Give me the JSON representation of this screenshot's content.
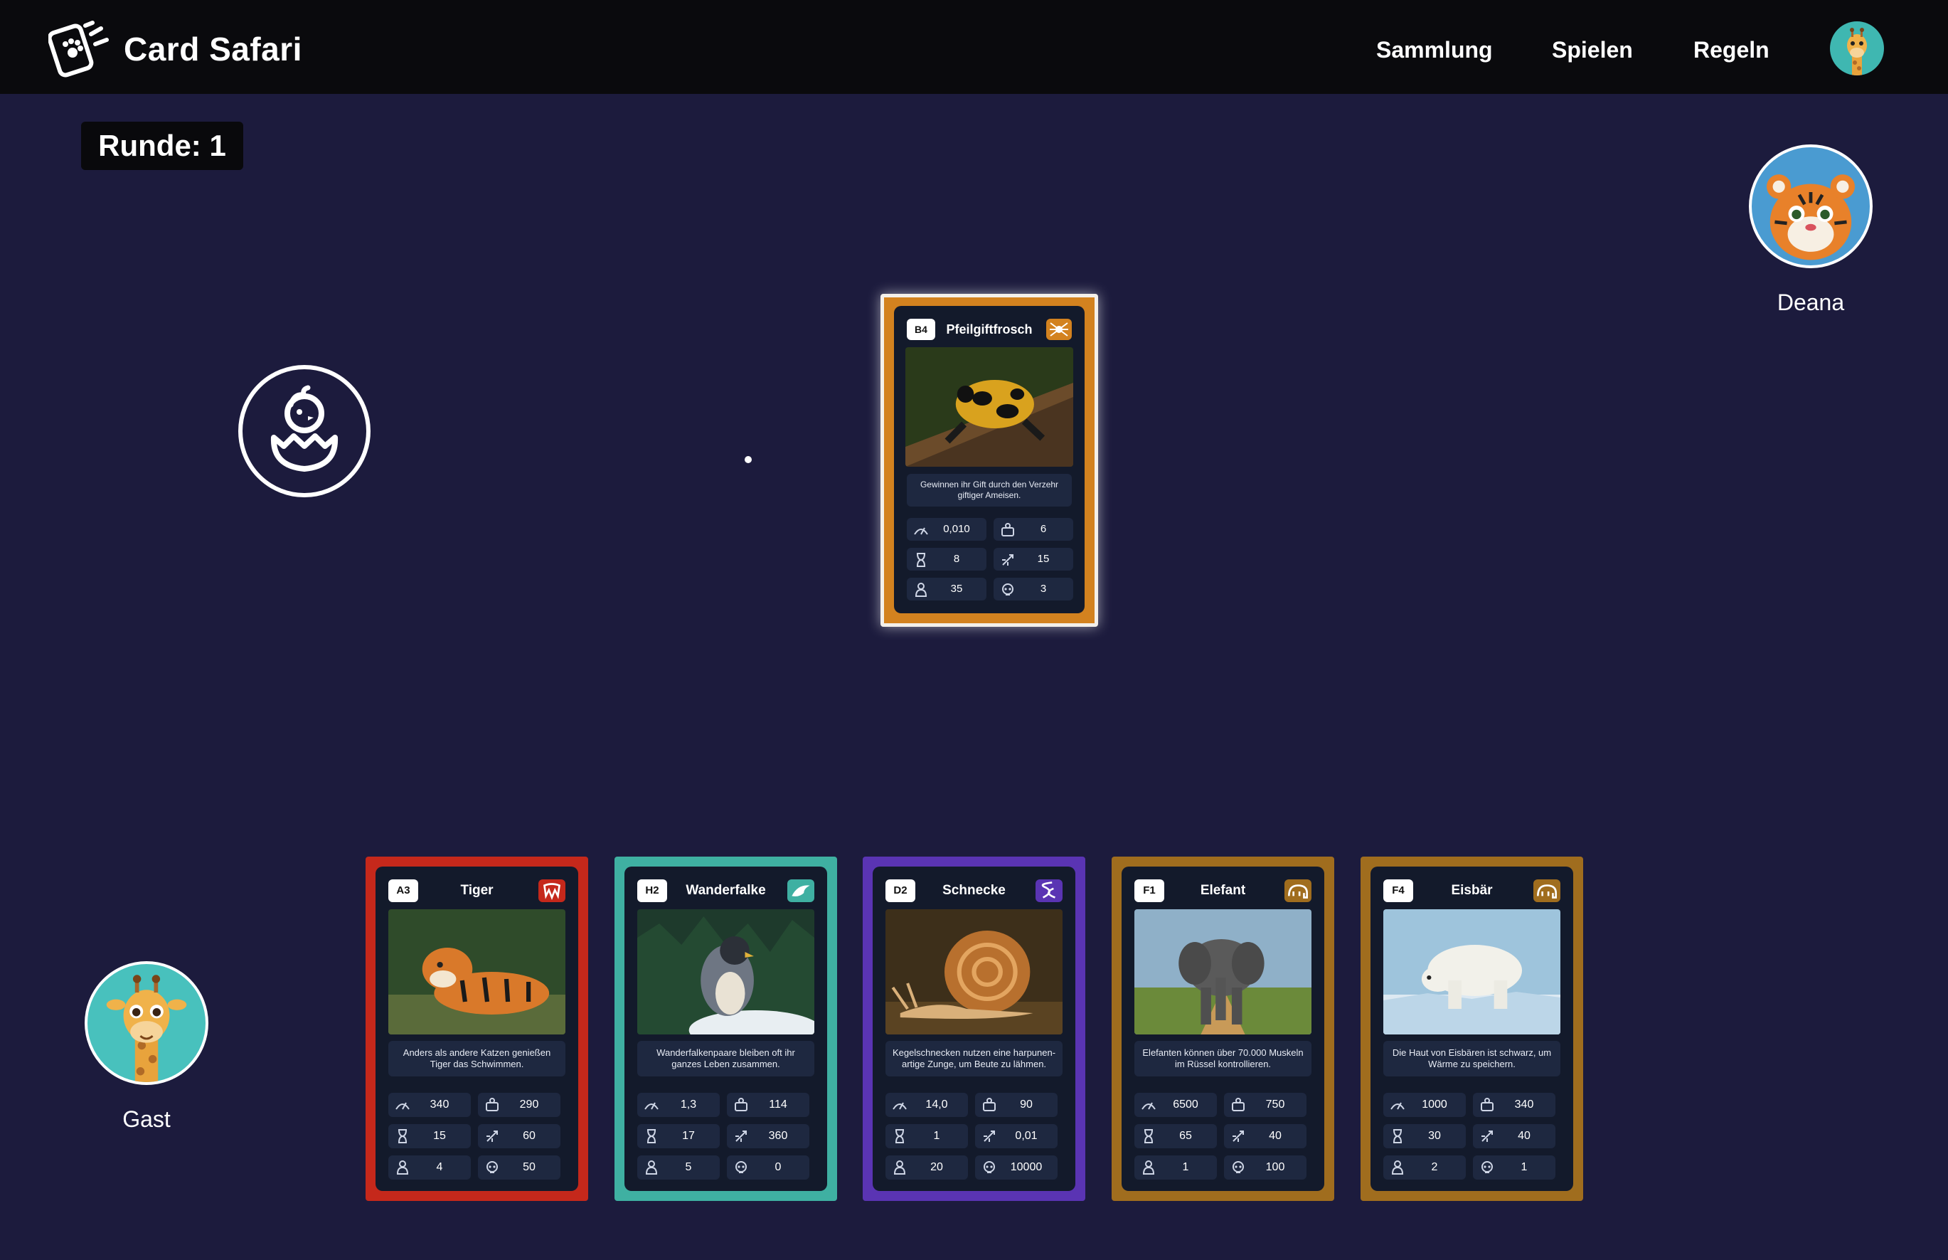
{
  "app": {
    "title": "Card Safari",
    "logo_icon": "paw-cards-icon"
  },
  "nav": {
    "items": [
      {
        "label": "Sammlung"
      },
      {
        "label": "Spielen"
      },
      {
        "label": "Regeln"
      }
    ],
    "avatar_icon": "giraffe-avatar-icon"
  },
  "round": {
    "label": "Runde: 1"
  },
  "opponent": {
    "name": "Deana",
    "avatar_icon": "tiger-avatar-icon"
  },
  "guest": {
    "name": "Gast",
    "avatar_icon": "giraffe-avatar-icon"
  },
  "deck": {
    "icon": "hatching-chick-icon"
  },
  "stat_icons": [
    "speed-icon",
    "weight-icon",
    "lifespan-hourglass-icon",
    "attack-icon",
    "offspring-icon",
    "danger-skull-icon"
  ],
  "played_card": {
    "code": "B4",
    "name": "Pfeilgiftfrosch",
    "type_icon": "spider-icon",
    "color": "#d3821f",
    "description": "Gewinnen ihr Gift durch den Verzehr giftiger Ameisen.",
    "stats": [
      "0,010",
      "6",
      "8",
      "15",
      "35",
      "3"
    ]
  },
  "hand": [
    {
      "code": "A3",
      "name": "Tiger",
      "type_icon": "fangs-icon",
      "color": "#c5281b",
      "description": "Anders als andere Katzen genießen Tiger das Schwimmen.",
      "stats": [
        "340",
        "290",
        "15",
        "60",
        "4",
        "50"
      ]
    },
    {
      "code": "H2",
      "name": "Wanderfalke",
      "type_icon": "bird-icon",
      "color": "#3fb0a2",
      "description": "Wanderfalkenpaare bleiben oft ihr ganzes Leben zusammen.",
      "stats": [
        "1,3",
        "114",
        "17",
        "360",
        "5",
        "0"
      ]
    },
    {
      "code": "D2",
      "name": "Schnecke",
      "type_icon": "dna-icon",
      "color": "#5a34b3",
      "description": "Kegelschnecken nutzen eine harpunen-artige Zunge, um Beute zu lähmen.",
      "stats": [
        "14,0",
        "90",
        "1",
        "0,01",
        "20",
        "10000"
      ]
    },
    {
      "code": "F1",
      "name": "Elefant",
      "type_icon": "elephant-icon",
      "color": "#a06d1e",
      "description": "Elefanten können über 70.000 Muskeln im Rüssel kontrollieren.",
      "stats": [
        "6500",
        "750",
        "65",
        "40",
        "1",
        "100"
      ]
    },
    {
      "code": "F4",
      "name": "Eisbär",
      "type_icon": "elephant-icon",
      "color": "#a06d1e",
      "description": "Die Haut von Eisbären ist schwarz, um Wärme zu speichern.",
      "stats": [
        "1000",
        "340",
        "30",
        "40",
        "2",
        "1"
      ]
    }
  ]
}
